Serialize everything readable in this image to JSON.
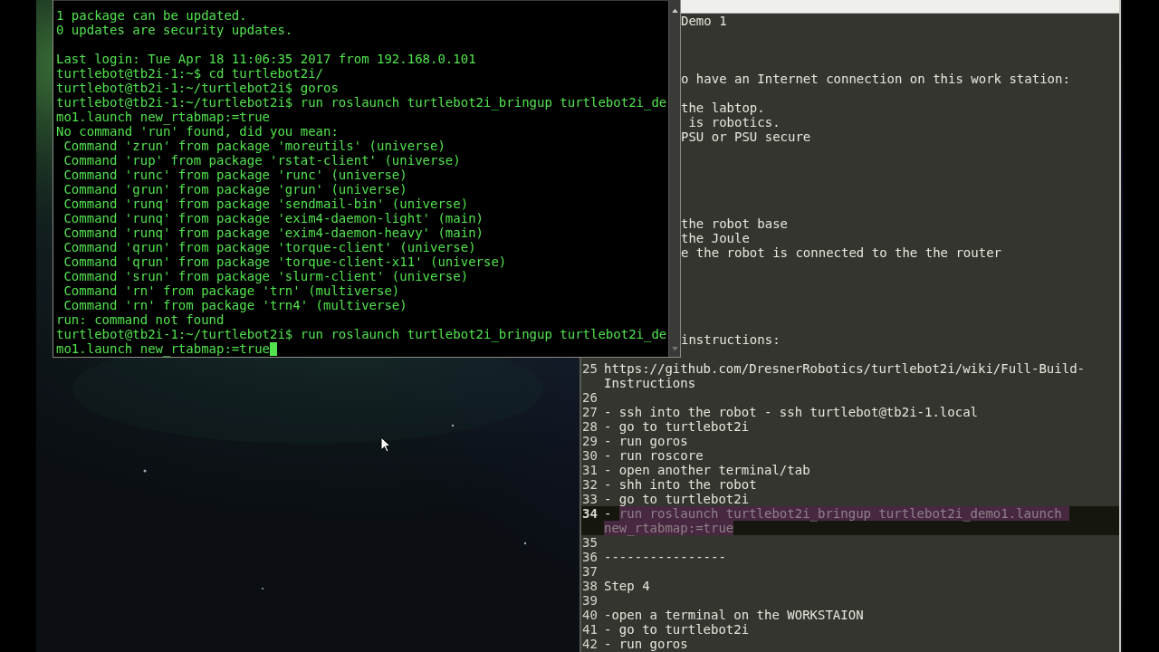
{
  "terminal": {
    "blocks": [
      [
        "1 package can be updated.",
        "0 updates are security updates."
      ],
      [
        "Last login: Tue Apr 18 11:06:35 2017 from 192.168.0.101",
        "turtlebot@tb2i-1:~$ cd turtlebot2i/",
        "turtlebot@tb2i-1:~/turtlebot2i$ goros",
        "turtlebot@tb2i-1:~/turtlebot2i$ run roslaunch turtlebot2i_bringup turtlebot2i_de",
        "mo1.launch new_rtabmap:=true",
        "No command 'run' found, did you mean:",
        " Command 'zrun' from package 'moreutils' (universe)",
        " Command 'rup' from package 'rstat-client' (universe)",
        " Command 'runc' from package 'runc' (universe)",
        " Command 'grun' from package 'grun' (universe)",
        " Command 'runq' from package 'sendmail-bin' (universe)",
        " Command 'runq' from package 'exim4-daemon-light' (main)",
        " Command 'runq' from package 'exim4-daemon-heavy' (main)",
        " Command 'qrun' from package 'torque-client' (universe)",
        " Command 'qrun' from package 'torque-client-x11' (universe)",
        " Command 'srun' from package 'slurm-client' (universe)",
        " Command 'rn' from package 'trn' (multiverse)",
        " Command 'rn' from package 'trn4' (multiverse)",
        "run: command not found",
        "turtlebot@tb2i-1:~/turtlebot2i$ run roslaunch turtlebot2i_bringup turtlebot2i_de",
        "mo1.launch new_rtabmap:=true"
      ]
    ]
  },
  "editor": {
    "partial_rows": [
      {
        "kind": "text",
        "text": "Demo 1"
      },
      {
        "kind": "blank"
      },
      {
        "kind": "blank"
      },
      {
        "kind": "blank"
      },
      {
        "kind": "text",
        "text": "o have an Internet connection on this work station:"
      },
      {
        "kind": "blank"
      },
      {
        "kind": "text",
        "text": "the labtop."
      },
      {
        "kind": "text",
        "text": " is robotics."
      },
      {
        "kind": "text",
        "text": "PSU or PSU secure"
      },
      {
        "kind": "blank"
      },
      {
        "kind": "blank"
      },
      {
        "kind": "blank"
      },
      {
        "kind": "blank"
      },
      {
        "kind": "blank"
      },
      {
        "kind": "text",
        "text": "the robot base"
      },
      {
        "kind": "text",
        "text": "the Joule"
      },
      {
        "kind": "text",
        "text": "e the robot is connected to the the router"
      },
      {
        "kind": "blank"
      },
      {
        "kind": "blank"
      },
      {
        "kind": "blank"
      },
      {
        "kind": "blank"
      },
      {
        "kind": "blank"
      },
      {
        "kind": "text",
        "text": "instructions:"
      },
      {
        "kind": "blank"
      }
    ],
    "lines": [
      {
        "number": "25",
        "text": "https://github.com/DresnerRobotics/turtlebot2i/wiki/Full-Build-Instructions",
        "current": false
      },
      {
        "number": "26",
        "current": false
      },
      {
        "number": "27",
        "text": "- ssh into the robot - ssh turtlebot@tb2i-1.local",
        "current": false
      },
      {
        "number": "28",
        "text": "- go to turtlebot2i",
        "current": false
      },
      {
        "number": "29",
        "text": "- run goros",
        "current": false
      },
      {
        "number": "30",
        "text": "- run roscore",
        "current": false
      },
      {
        "number": "31",
        "text": "- open another terminal/tab",
        "current": false
      },
      {
        "number": "32",
        "text": "- shh into the robot",
        "current": false
      },
      {
        "number": "33",
        "text": "- go to turtlebot2i",
        "current": false
      },
      {
        "number": "34",
        "text": "- ",
        "selected_text": "run roslaunch turtlebot2i_bringup turtlebot2i_demo1.launch new_rtabmap:=true",
        "current": true
      },
      {
        "number": "35",
        "current": false
      },
      {
        "number": "36",
        "text": "----------------",
        "current": false
      },
      {
        "number": "37",
        "current": false
      },
      {
        "number": "38",
        "text": "Step 4",
        "current": false
      },
      {
        "number": "39",
        "current": false
      },
      {
        "number": "40",
        "text": "-open a terminal on the WORKSTAION",
        "current": false
      },
      {
        "number": "41",
        "text": "- go to turtlebot2i",
        "current": false
      },
      {
        "number": "42",
        "text": "- run goros",
        "current": false
      }
    ]
  }
}
